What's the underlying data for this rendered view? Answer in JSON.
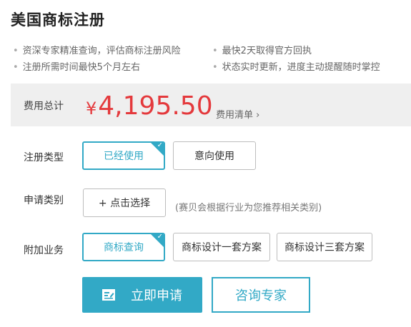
{
  "title": "美国商标注册",
  "features": [
    "资深专家精准查询，评估商标注册风险",
    "最快2天取得官方回执",
    "注册所需时间最快5个月左右",
    "状态实时更新，进度主动提醒随时掌控"
  ],
  "price": {
    "label": "费用总计",
    "currency": "¥",
    "amount": "4,195.50",
    "detail_link": "费用清单",
    "detail_chevron": "›"
  },
  "registration_type": {
    "label": "注册类型",
    "options": [
      "已经使用",
      "意向使用"
    ],
    "selected": "已经使用"
  },
  "category": {
    "label": "申请类别",
    "button": "+ 点击选择",
    "hint": "(赛贝会根据行业为您推荐相关类别)"
  },
  "addons": {
    "label": "附加业务",
    "options": [
      "商标查询",
      "商标设计一套方案",
      "商标设计三套方案"
    ],
    "selected": "商标查询"
  },
  "actions": {
    "apply": "立即申请",
    "consult": "咨询专家"
  },
  "check_mark": "✓",
  "colors": {
    "accent": "#32a9c6",
    "price": "#e4393c",
    "bar": "#efefef"
  }
}
